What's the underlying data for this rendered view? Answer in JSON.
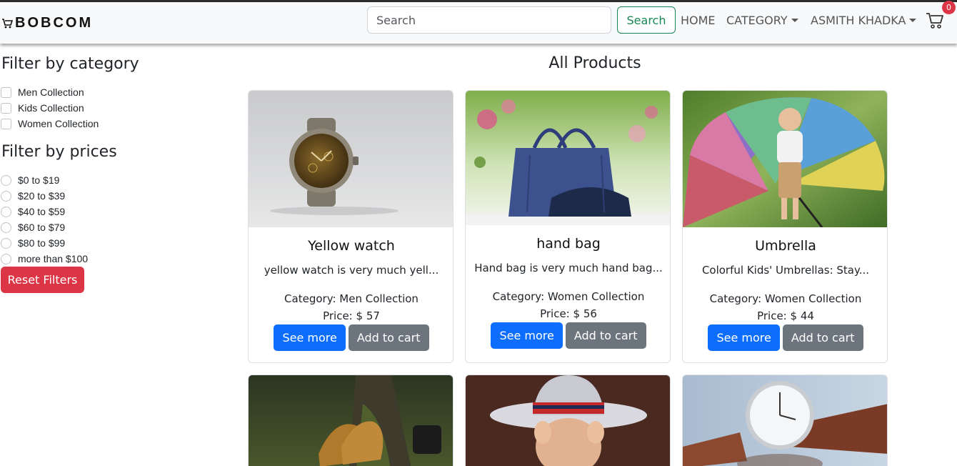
{
  "navbar": {
    "brand": "BOBCOM",
    "search_placeholder": "Search",
    "search_button": "Search",
    "links": {
      "home": "HOME",
      "category": "CATEGORY",
      "user": "ASMITH KHADKA"
    },
    "cart_count": "0"
  },
  "sidebar": {
    "category_title": "Filter by category",
    "categories": [
      "Men Collection",
      "Kids Collection",
      "Women Collection"
    ],
    "price_title": "Filter by prices",
    "prices": [
      "$0 to $19",
      "$20 to $39",
      "$40 to $59",
      "$60 to $79",
      "$80 to $99",
      "more than $100"
    ],
    "reset_button": "Reset Filters"
  },
  "main": {
    "title": "All Products",
    "products": [
      {
        "name": "Yellow watch",
        "desc": "yellow watch is very much yell...",
        "category": "Category: Men Collection",
        "price": "Price: $ 57",
        "image": "watch-photo"
      },
      {
        "name": "hand bag",
        "desc": "Hand bag is very much hand bag...",
        "category": "Category: Women Collection",
        "price": "Price: $ 56",
        "image": "handbag-photo"
      },
      {
        "name": "Umbrella",
        "desc": "Colorful Kids' Umbrellas: Stay...",
        "category": "Category: Women Collection",
        "price": "Price: $ 44",
        "image": "umbrella-photo"
      }
    ],
    "second_row_images": [
      "boots-photo",
      "baby-hat-photo",
      "wristwatch-photo"
    ],
    "see_more": "See more",
    "add_to_cart": "Add to cart"
  },
  "colors": {
    "primary": "#0d6efd",
    "secondary": "#6c757d",
    "danger": "#dc3545",
    "success": "#198754"
  }
}
